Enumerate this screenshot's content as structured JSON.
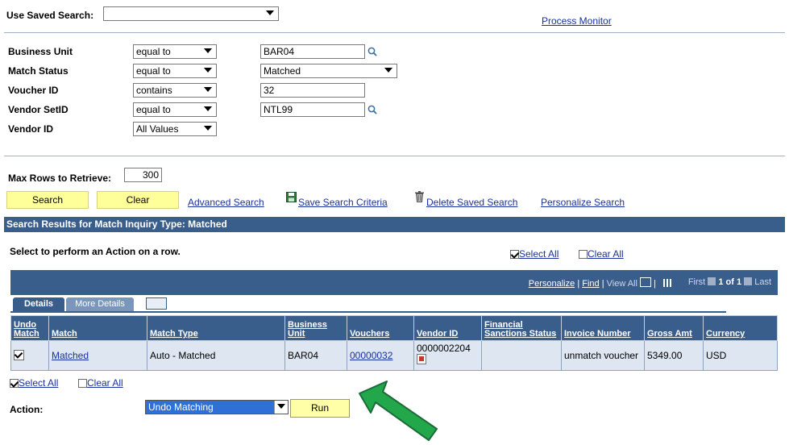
{
  "saved_search": {
    "label": "Use Saved Search:",
    "value": ""
  },
  "process_monitor": "Process Monitor",
  "criteria": [
    {
      "label": "Business Unit",
      "operator": "equal to",
      "value": "BAR04"
    },
    {
      "label": "Match Status",
      "operator": "equal to",
      "value": "Matched"
    },
    {
      "label": "Voucher ID",
      "operator": "contains",
      "value": "32"
    },
    {
      "label": "Vendor SetID",
      "operator": "equal to",
      "value": "NTL99"
    },
    {
      "label": "Vendor ID",
      "operator": "All Values",
      "value": ""
    }
  ],
  "max_rows": {
    "label": "Max Rows to Retrieve:",
    "value": "300"
  },
  "buttons": {
    "search": "Search",
    "clear": "Clear",
    "advanced_search": "Advanced Search",
    "save_search": "Save Search Criteria",
    "delete_saved": "Delete Saved Search",
    "personalize_search": "Personalize Search"
  },
  "results": {
    "title": "Search Results for Match Inquiry Type: Matched",
    "instruction": "Select to perform an Action on a row.",
    "select_all": "Select All",
    "clear_all": "Clear All",
    "nav": {
      "personalize": "Personalize",
      "separator1": "|",
      "find": "Find",
      "separator2": "|",
      "view_all": "View All",
      "separator3": "|",
      "first": "First",
      "page": "1 of 1",
      "last": "Last"
    },
    "tabs": [
      "Details",
      "More Details"
    ],
    "columns": [
      "Undo Match",
      "Match",
      "Match Type",
      "Business Unit",
      "Vouchers",
      "Vendor ID",
      "Financial Sanctions Status",
      "Invoice Number",
      "Gross Amt",
      "Currency"
    ],
    "rows": [
      {
        "undo": true,
        "match": "Matched",
        "match_type": "Auto - Matched",
        "business_unit": "BAR04",
        "vouchers": "00000032",
        "vendor_id": "0000002204",
        "sanctions": "",
        "invoice": "unmatch voucher",
        "gross_amt": "5349.00",
        "currency": "USD"
      }
    ]
  },
  "bottom": {
    "select_all": "Select All",
    "clear_all": "Clear All",
    "action_label": "Action:",
    "action_value": "Undo Matching",
    "run": "Run"
  },
  "colors": {
    "header_bar": "#3a5e8c",
    "button": "#ffff99",
    "link": "#1a30a0",
    "arrow": "#22a84a"
  }
}
